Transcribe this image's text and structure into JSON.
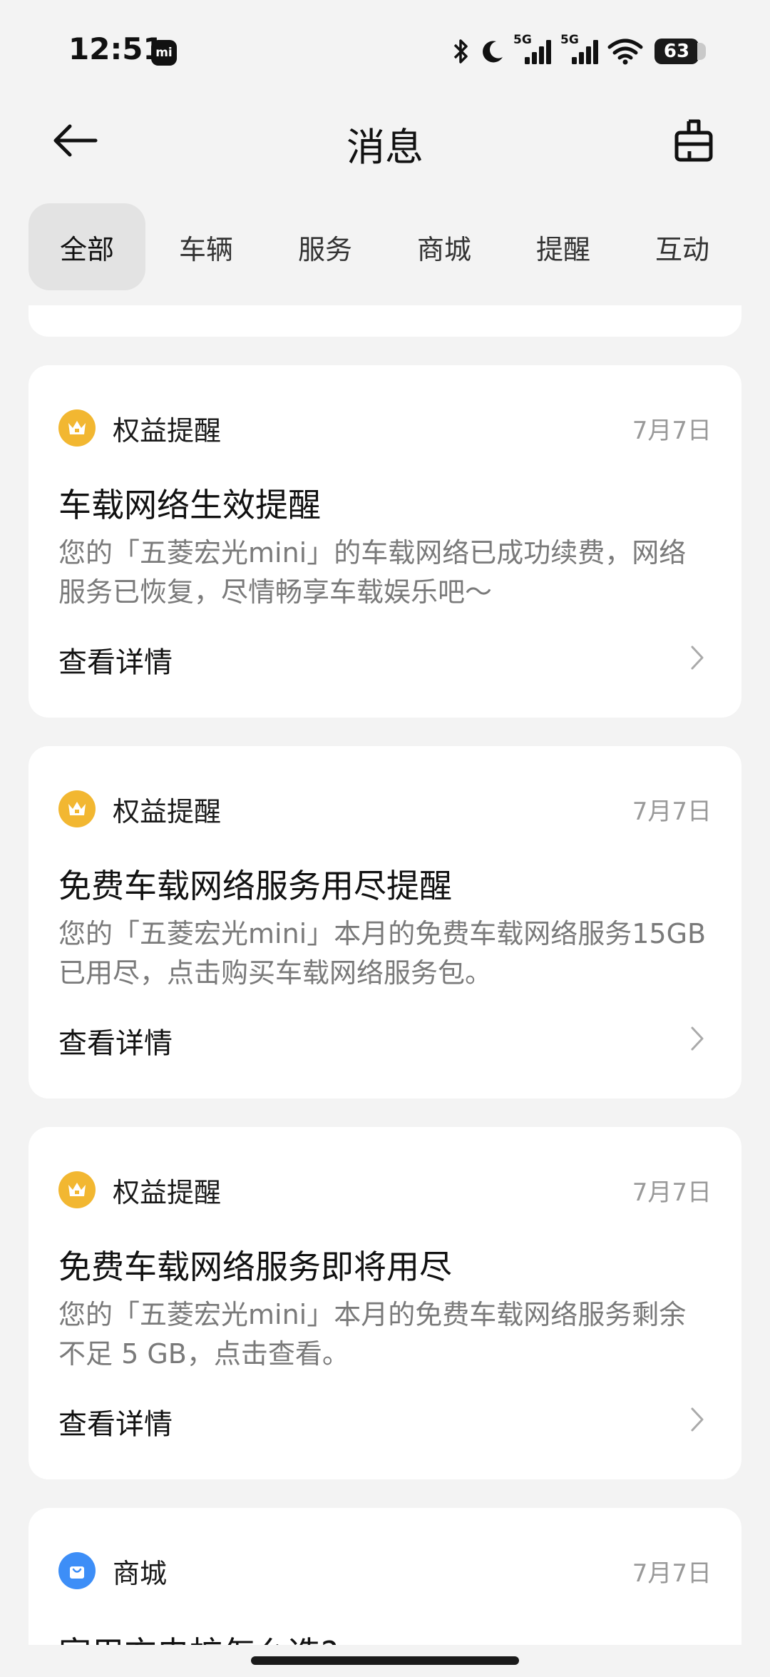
{
  "status_bar": {
    "time": "12:51",
    "mi_badge": "mi",
    "network_1": "5G",
    "network_2": "5G",
    "battery": "63"
  },
  "header": {
    "title": "消息",
    "back_icon": "back-arrow-icon",
    "right_icon": "clean-brush-icon"
  },
  "tabs": [
    {
      "label": "全部",
      "active": true
    },
    {
      "label": "车辆",
      "active": false
    },
    {
      "label": "服务",
      "active": false
    },
    {
      "label": "商城",
      "active": false
    },
    {
      "label": "提醒",
      "active": false
    },
    {
      "label": "互动",
      "active": false
    }
  ],
  "messages": [
    {
      "category": "权益提醒",
      "icon": "crown-icon",
      "date": "7月7日",
      "title": "车载网络生效提醒",
      "body": "您的「五菱宏光mini」的车载网络已成功续费，网络服务已恢复，尽情畅享车载娱乐吧～",
      "detail_label": "查看详情"
    },
    {
      "category": "权益提醒",
      "icon": "crown-icon",
      "date": "7月7日",
      "title": "免费车载网络服务用尽提醒",
      "body": "您的「五菱宏光mini」本月的免费车载网络服务15GB 已用尽，点击购买车载网络服务包。",
      "detail_label": "查看详情"
    },
    {
      "category": "权益提醒",
      "icon": "crown-icon",
      "date": "7月7日",
      "title": "免费车载网络服务即将用尽",
      "body": "您的「五菱宏光mini」本月的免费车载网络服务剩余不足 5 GB，点击查看。",
      "detail_label": "查看详情"
    },
    {
      "category": "商城",
      "icon": "shopping-bag-icon",
      "date": "7月7日",
      "title": "家用充电桩怎么选?"
    }
  ],
  "colors": {
    "background": "#f3f3f3",
    "card": "#ffffff",
    "gold_badge": "#f2b731",
    "blue_badge": "#3d8ef7",
    "muted_text": "#7a7a7a"
  }
}
